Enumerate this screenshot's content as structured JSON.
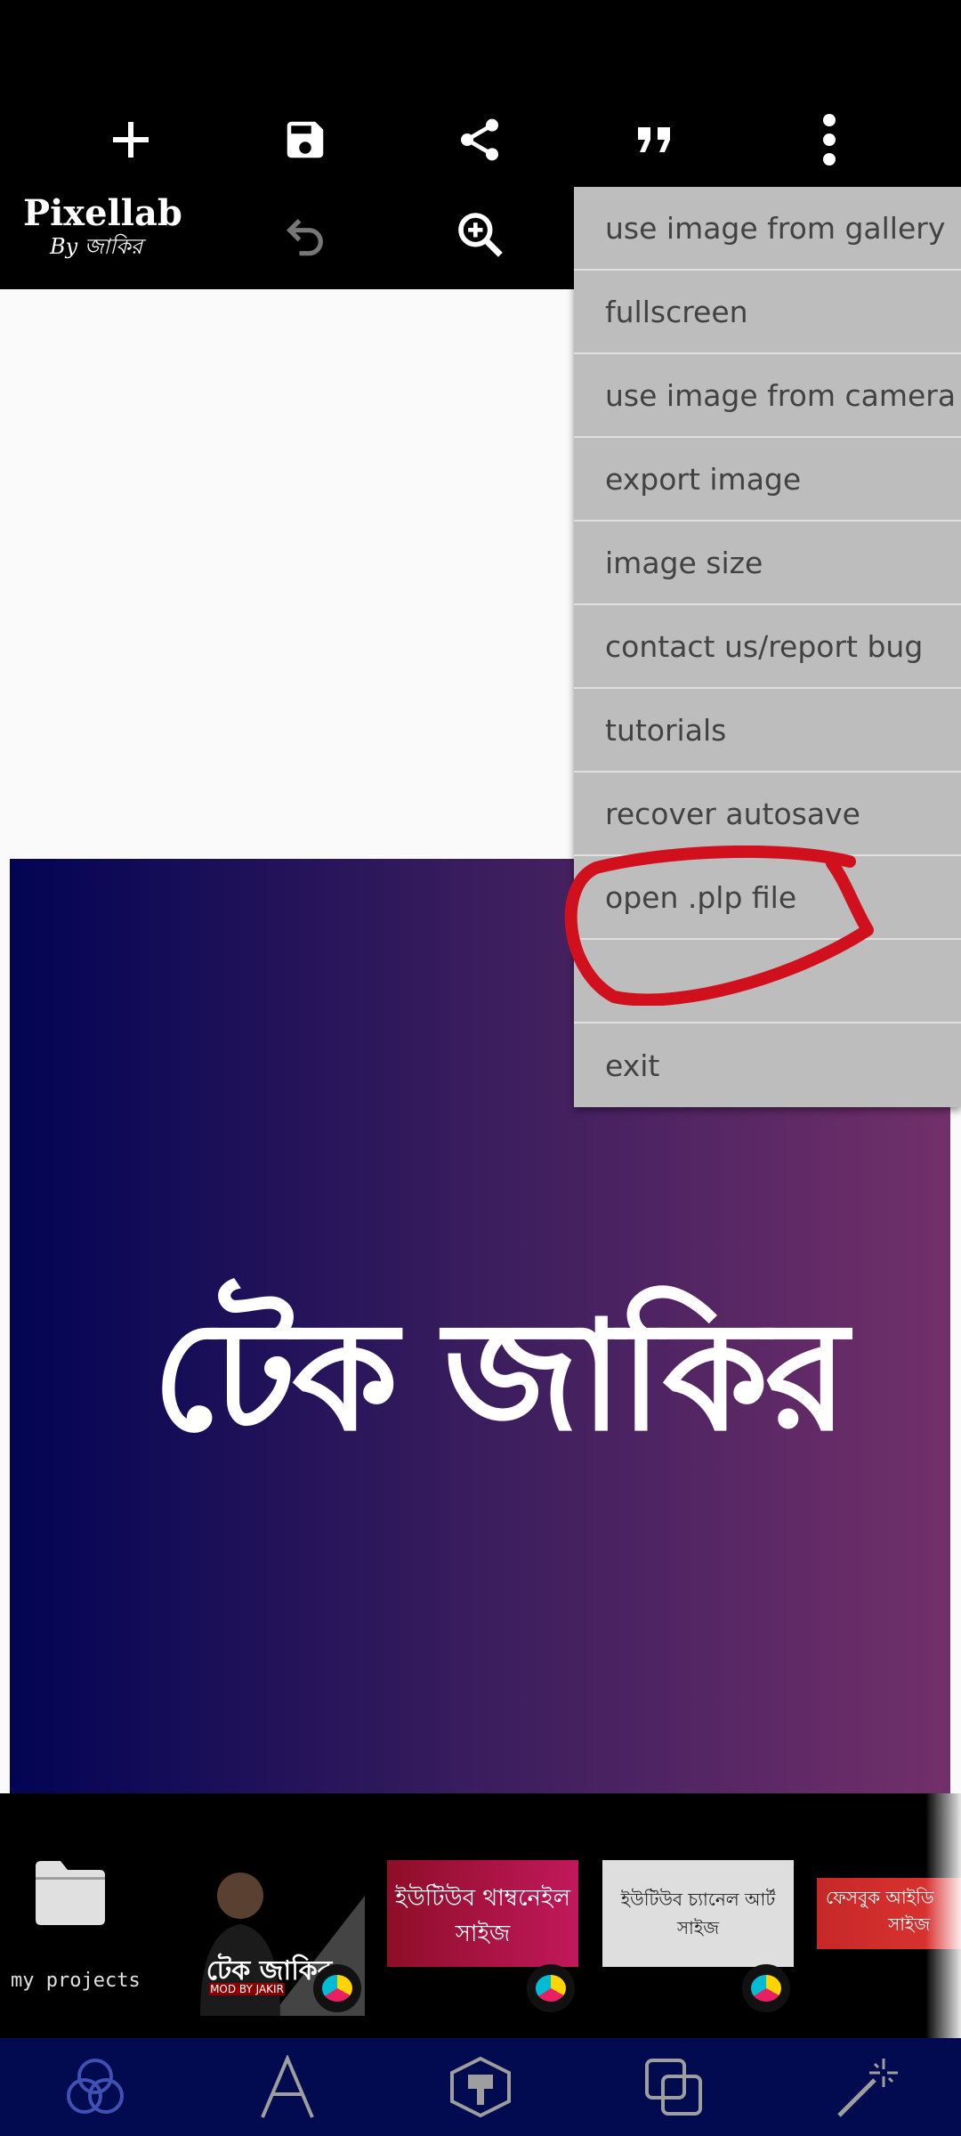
{
  "app": {
    "logo_main": "Pixellab",
    "logo_sub": "By জাকির"
  },
  "toolbar": {
    "icons": [
      "plus-icon",
      "save-icon",
      "share-icon",
      "quote-icon",
      "more-vert-icon",
      "undo-icon",
      "zoom-in-icon"
    ]
  },
  "canvas": {
    "text": "টেক জাকির",
    "gradient": [
      "#020454",
      "#72306a"
    ]
  },
  "menu": {
    "items": [
      "use image from gallery",
      "fullscreen",
      "use image from camera",
      "export image",
      "image size",
      "contact us/report bug",
      "tutorials",
      "recover autosave",
      "open .plp file",
      "",
      "exit"
    ]
  },
  "strip": {
    "my_projects_label": "my projects",
    "templates": [
      {
        "line1": "টেক জাকির",
        "line2": "MOD BY JAKIR"
      },
      {
        "line1": "ইউটিউব থাম্বনেইল",
        "line2": "সাইজ"
      },
      {
        "line1": "ইউটিউব চ্যানেল আর্ট",
        "line2": "সাইজ"
      },
      {
        "line1": "ফেসবুক আইডি",
        "line2": "সাইজ"
      }
    ]
  },
  "bottom_nav": {
    "icons": [
      "layers-icon",
      "text-icon",
      "shape-3d-icon",
      "duplicate-icon",
      "magic-wand-icon"
    ]
  },
  "colors": {
    "accent": "#3f51b5",
    "annotation": "#d0101d",
    "menu_bg": "#bdbdbd"
  }
}
